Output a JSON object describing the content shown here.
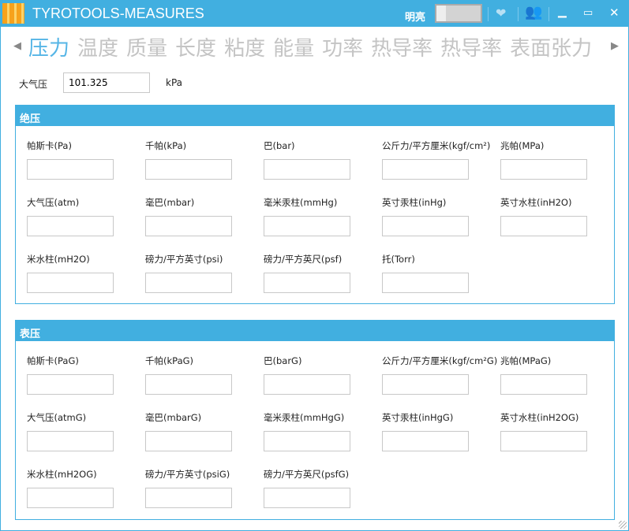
{
  "app": {
    "title": "TYROTOOLS-MEASURES",
    "theme_label": "明亮",
    "theme_toggle_on": false
  },
  "tabs": [
    "压力",
    "温度",
    "质量",
    "长度",
    "粘度",
    "能量",
    "功率",
    "热导率",
    "热导率",
    "表面张力"
  ],
  "active_tab": "压力",
  "atmosphere": {
    "label": "大气压",
    "value": "101.325",
    "unit": "kPa"
  },
  "absolute": {
    "title": "绝压",
    "fields": [
      "帕斯卡(Pa)",
      "千帕(kPa)",
      "巴(bar)",
      "公斤力/平方厘米(kgf/cm²)",
      "兆帕(MPa)",
      "大气压(atm)",
      "毫巴(mbar)",
      "毫米汞柱(mmHg)",
      "英寸汞柱(inHg)",
      "英寸水柱(inH2O)",
      "米水柱(mH2O)",
      "磅力/平方英寸(psi)",
      "磅力/平方英尺(psf)",
      "托(Torr)"
    ]
  },
  "gauge": {
    "title": "表压",
    "fields": [
      "帕斯卡(PaG)",
      "千帕(kPaG)",
      "巴(barG)",
      "公斤力/平方厘米(kgf/cm²G)",
      "兆帕(MPaG)",
      "大气压(atmG)",
      "毫巴(mbarG)",
      "毫米汞柱(mmHgG)",
      "英寸汞柱(inHgG)",
      "英寸水柱(inH2OG)",
      "米水柱(mH2OG)",
      "磅力/平方英寸(psiG)",
      "磅力/平方英尺(psfG)"
    ]
  }
}
